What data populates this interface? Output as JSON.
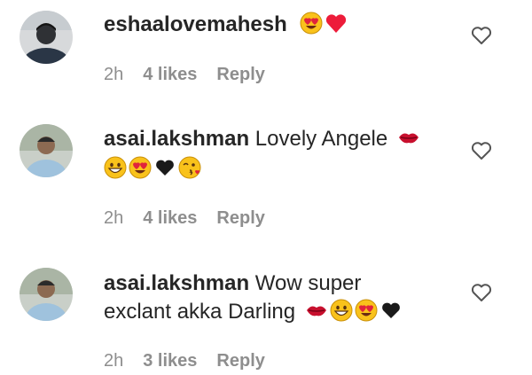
{
  "comments": [
    {
      "username": "eshaalovemahesh",
      "text": "",
      "line1_emojis": [
        "heart-eyes-emoji",
        "red-heart-emoji"
      ],
      "line2_text": "",
      "line2_emojis": [],
      "time": "2h",
      "likes": "4 likes",
      "reply": "Reply"
    },
    {
      "username": "asai.lakshman",
      "text": "Lovely Angele",
      "line1_emojis": [
        "lips-emoji"
      ],
      "line2_text": "",
      "line2_emojis": [
        "grinning-emoji",
        "heart-eyes-emoji",
        "black-heart-emoji",
        "kissing-heart-emoji"
      ],
      "time": "2h",
      "likes": "4 likes",
      "reply": "Reply"
    },
    {
      "username": "asai.lakshman",
      "text": "Wow super",
      "line1_emojis": [],
      "line2_text": "exclant akka Darling",
      "line2_emojis": [
        "lips-emoji",
        "grinning-emoji",
        "heart-eyes-emoji",
        "black-heart-emoji"
      ],
      "time": "2h",
      "likes": "3 likes",
      "reply": "Reply"
    }
  ],
  "colors": {
    "text": "#262626",
    "meta": "#8e8e8e",
    "heart_red": "#ed1c3a",
    "emoji_yellow": "#f9c21b"
  }
}
